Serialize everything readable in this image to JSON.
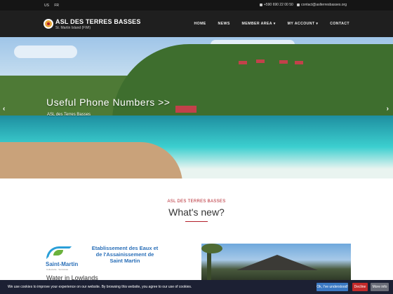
{
  "topbar": {
    "languages": [
      "US",
      "FR"
    ],
    "phone": "+590 690 22 00 50",
    "email": "contact@aslterresbasses.org"
  },
  "header": {
    "logo_title": "ASL DES TERRES BASSES",
    "logo_subtitle": "St. Martin Island (FWI)",
    "nav": [
      "HOME",
      "NEWS",
      "MEMBER AREA",
      "MY ACCOUNT",
      "CONTACT"
    ],
    "nav_dropdown_marker": "▾"
  },
  "hero": {
    "title": "Useful Phone Numbers >>",
    "subtitle": "ASL des Terres Basses",
    "prev_arrow": "‹",
    "next_arrow": "›"
  },
  "whats_new": {
    "kicker": "ASL DES TERRES BASSES",
    "heading": "What's new?"
  },
  "cards": [
    {
      "logo_name": "Saint-Martin",
      "logo_tag": "Collectivité · Territoriale",
      "logo_text": "Etablissement des Eaux et de l'Assainissement de Saint Martin",
      "title": "Water in Lowlands"
    }
  ],
  "cookie": {
    "message": "We use cookies to improve your experience on our website. By browsing this website, you agree to our use of cookies.",
    "accept_label": "Ok, I've understood!",
    "decline_label": "Decline",
    "more_label": "More info"
  },
  "colors": {
    "accent": "#b3202a",
    "topbar_bg": "#151515",
    "header_bg": "#1f1f1f",
    "cookie_bg": "#1c2033",
    "ok_button": "#3a78c3",
    "decline_button": "#c32a2a"
  }
}
